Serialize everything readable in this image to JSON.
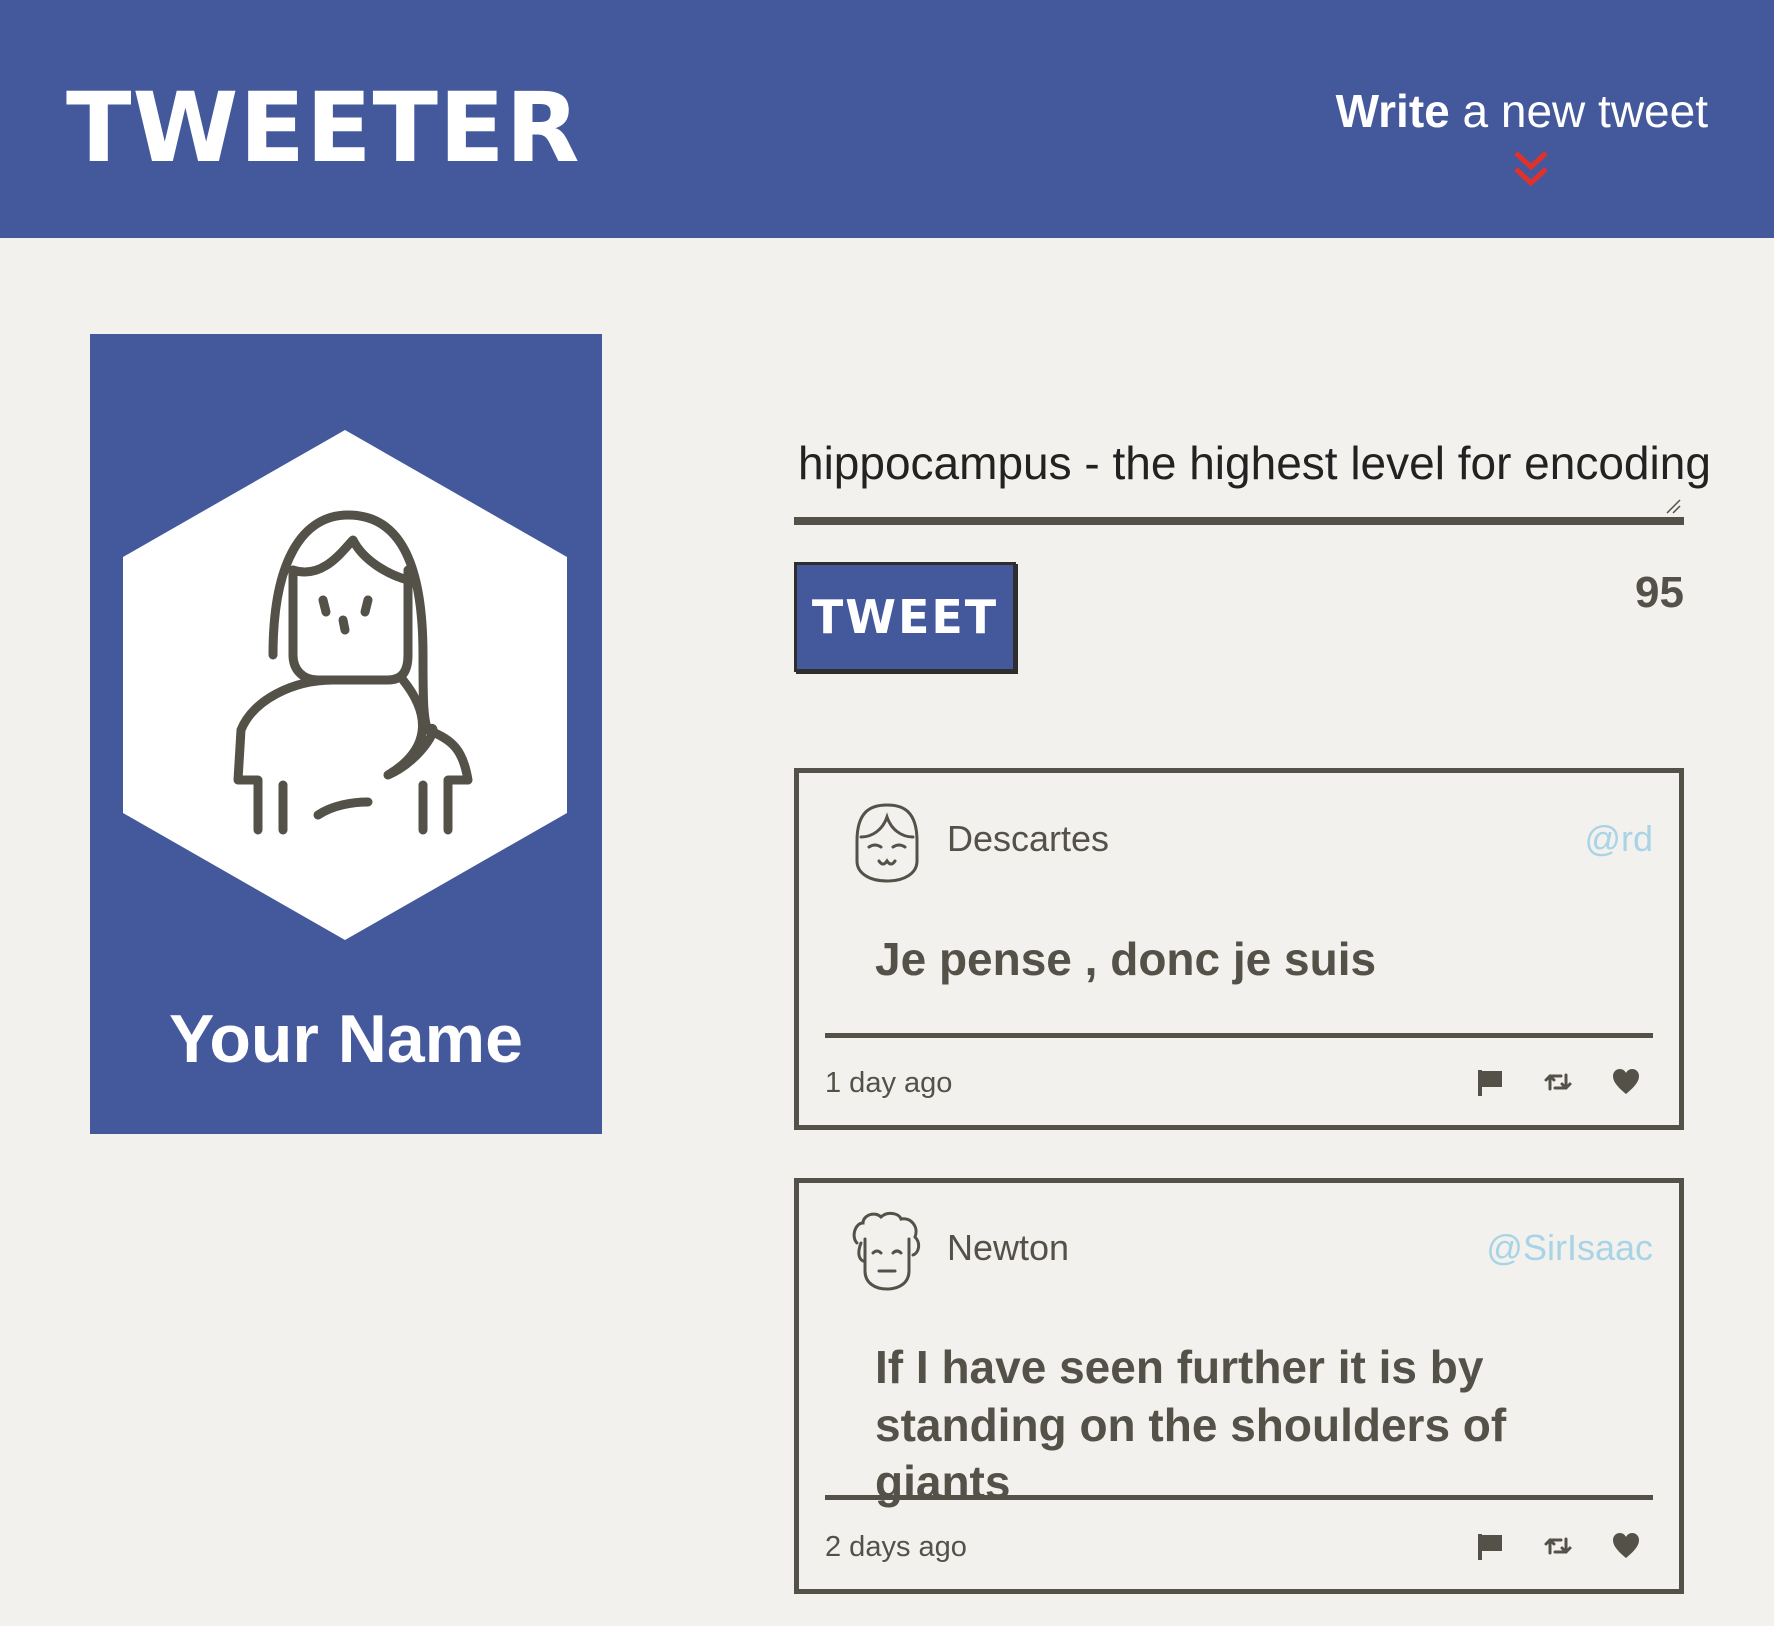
{
  "app": {
    "brand": "TWEETER",
    "compose_toggle": {
      "bold": "Write",
      "rest": " a new tweet"
    }
  },
  "colors": {
    "primary": "#44589c",
    "background": "#f2f1ed",
    "text": "#545149",
    "handle": "#a8d4e6",
    "chevron": "#e0322b"
  },
  "profile": {
    "name": "Your Name"
  },
  "composer": {
    "text": "hippocampus - the highest level for encoding",
    "button_label": "TWEET",
    "remaining": "95"
  },
  "tweets": [
    {
      "author": "Descartes",
      "handle": "@rd",
      "text": "Je pense , donc je suis",
      "time": "1 day ago",
      "actions": [
        "flag-icon",
        "retweet-icon",
        "heart-icon"
      ]
    },
    {
      "author": "Newton",
      "handle": "@SirIsaac",
      "text": "If I have seen further it is by standing on the shoulders of giants",
      "time": "2 days ago",
      "actions": [
        "flag-icon",
        "retweet-icon",
        "heart-icon"
      ]
    }
  ]
}
